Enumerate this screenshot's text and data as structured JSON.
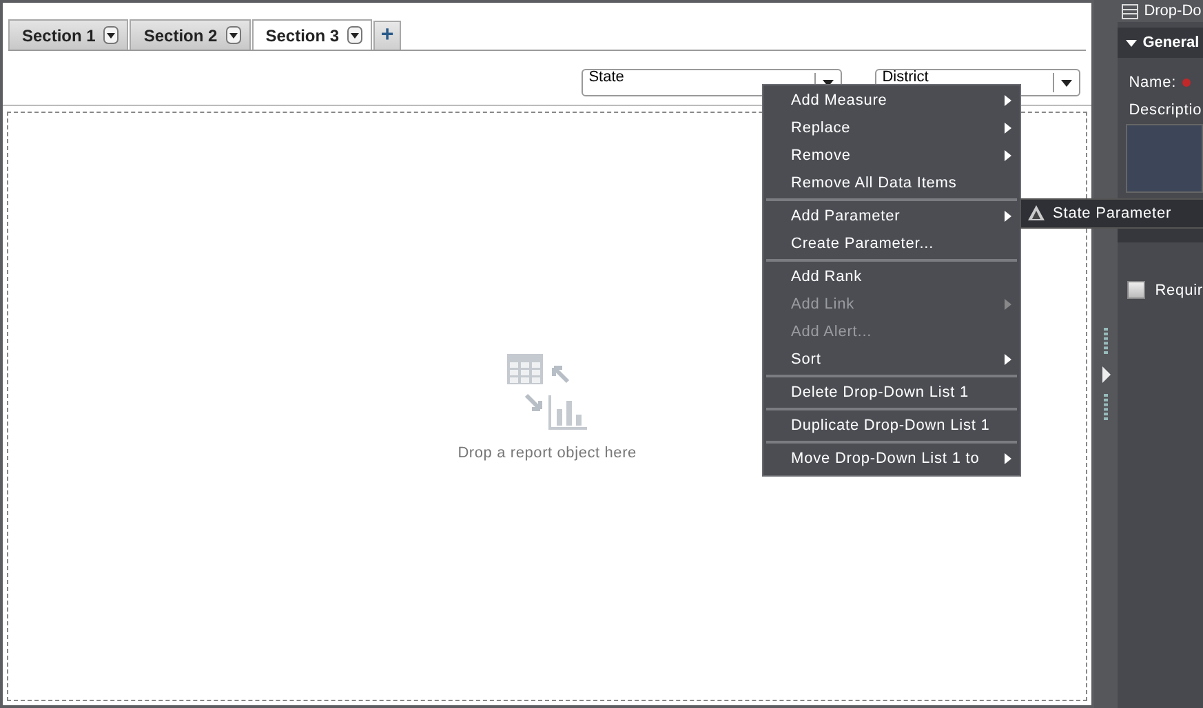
{
  "tabs": [
    {
      "label": "Section 1",
      "selected": false
    },
    {
      "label": "Section 2",
      "selected": false
    },
    {
      "label": "Section 3",
      "selected": true
    }
  ],
  "add_tab": "+",
  "dropdowns": [
    {
      "value": "State"
    },
    {
      "value": "District"
    }
  ],
  "drop_zone": {
    "hint": "Drop a report object here"
  },
  "context_menu": {
    "groups": [
      [
        {
          "label": "Add Measure",
          "submenu": true,
          "disabled": false
        },
        {
          "label": "Replace",
          "submenu": true,
          "disabled": false
        },
        {
          "label": "Remove",
          "submenu": true,
          "disabled": false
        },
        {
          "label": "Remove All Data Items",
          "submenu": false,
          "disabled": false
        }
      ],
      [
        {
          "label": "Add Parameter",
          "submenu": true,
          "disabled": false
        },
        {
          "label": "Create Parameter...",
          "submenu": false,
          "disabled": false
        }
      ],
      [
        {
          "label": "Add Rank",
          "submenu": false,
          "disabled": false
        },
        {
          "label": "Add Link",
          "submenu": true,
          "disabled": true
        },
        {
          "label": "Add Alert...",
          "submenu": false,
          "disabled": true
        },
        {
          "label": "Sort",
          "submenu": true,
          "disabled": false
        }
      ],
      [
        {
          "label": "Delete Drop-Down List 1",
          "submenu": false,
          "disabled": false
        }
      ],
      [
        {
          "label": "Duplicate Drop-Down List 1",
          "submenu": false,
          "disabled": false
        }
      ],
      [
        {
          "label": "Move Drop-Down List 1 to",
          "submenu": true,
          "disabled": false
        }
      ]
    ],
    "submenu": {
      "label": "State Parameter"
    }
  },
  "panel": {
    "title": "Drop-Do",
    "general": {
      "title": "General",
      "name_label": "Name:",
      "description_label": "Descriptio"
    },
    "required": {
      "label": "Requir",
      "checked": false
    }
  }
}
